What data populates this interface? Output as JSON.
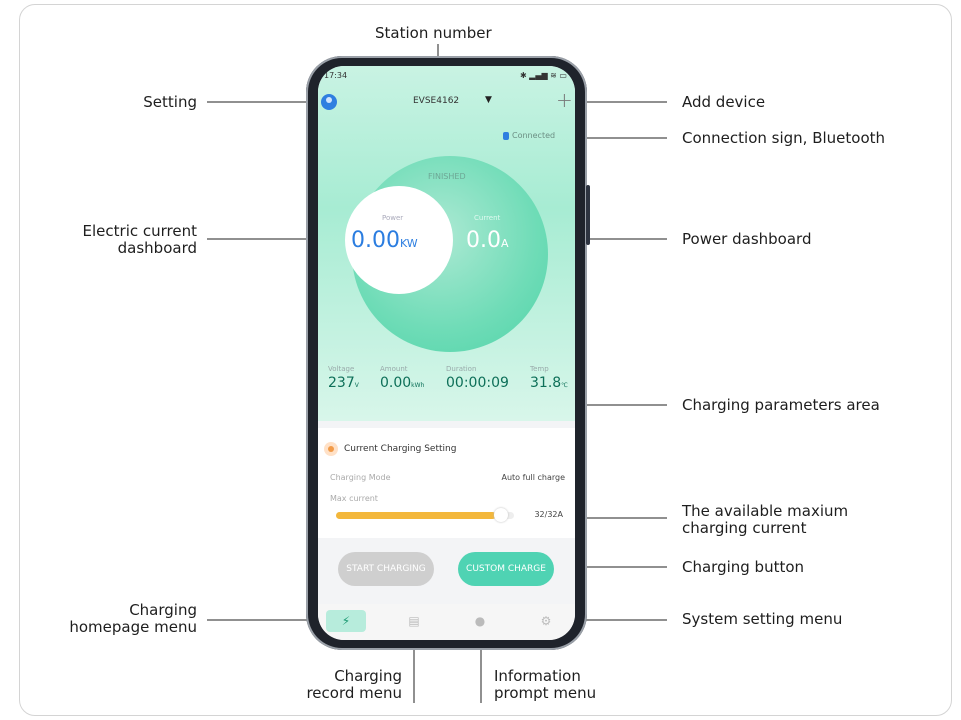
{
  "labels": {
    "station_number": "Station number",
    "setting": "Setting",
    "add_device": "Add device",
    "connection_sign": "Connection sign, Bluetooth",
    "electric_current_dashboard": [
      "Electric current",
      "dashboard"
    ],
    "power_dashboard": "Power dashboard",
    "charging_parameters_area": "Charging parameters area",
    "max_current": [
      "The available maxium",
      "charging current"
    ],
    "charging_button": "Charging button",
    "homepage_menu": [
      "Charging",
      "homepage menu"
    ],
    "system_setting_menu": "System setting menu",
    "record_menu": [
      "Charging",
      "record menu"
    ],
    "info_menu": [
      "Information",
      "prompt menu"
    ]
  },
  "phone": {
    "status_time": "17:34",
    "status_icons": "✱ ▂▄▆ ≋ ▭",
    "station_id": "EVSE4162",
    "connection": "Connected",
    "state": "FINISHED",
    "power_label": "Power",
    "power_value": "0.00",
    "power_unit": "KW",
    "current_label": "Current",
    "current_value": "0.0",
    "current_unit": "A",
    "params": [
      {
        "label": "Voltage",
        "value": "237",
        "unit": "V"
      },
      {
        "label": "Amount",
        "value": "0.00",
        "unit": "kWh"
      },
      {
        "label": "Duration",
        "value": "00:00:09",
        "unit": ""
      },
      {
        "label": "Temp",
        "value": "31.8",
        "unit": "℃"
      }
    ],
    "setting_title": "Current Charging Setting",
    "mode_label": "Charging Mode",
    "mode_value": "Auto full charge",
    "max_label": "Max current",
    "max_value": "32/32A",
    "max_fraction": 1.0,
    "start_button": "START CHARGING",
    "custom_button": "CUSTOM CHARGE"
  },
  "colors": {
    "accent": "#4fd3b3",
    "power_text": "#2b7de0",
    "bar": "#f3b73b"
  }
}
